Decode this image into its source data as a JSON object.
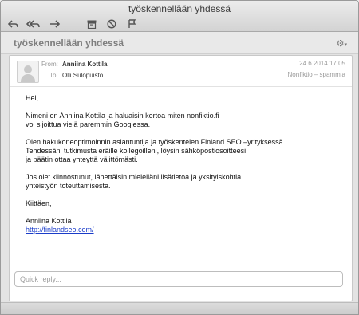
{
  "window": {
    "title": "työskennellään yhdessä"
  },
  "toolbar": {
    "reply_icon": "reply-icon",
    "reply_all_icon": "reply-all-icon",
    "forward_icon": "forward-icon",
    "archive_icon": "archive-icon",
    "junk_icon": "junk-icon",
    "flag_icon": "flag-icon"
  },
  "subject_bar": {
    "subject": "työskennellään yhdessä",
    "gear_icon": "gear-icon"
  },
  "message": {
    "from_label": "From:",
    "from_name": "Anniina Kottila",
    "to_label": "To:",
    "to_name": "Olli Sulopuisto",
    "date": "24.6.2014 17.05",
    "folder": "Nonfiktio – spammia",
    "body": {
      "greeting": "Hei,",
      "p1": "Nimeni on Anniina Kottila ja haluaisin kertoa miten nonfiktio.fi\nvoi sijoittua vielä paremmin Googlessa.",
      "p2": "Olen hakukoneoptimoinnin asiantuntija ja työskentelen Finland SEO –yrityksessä.\nTehdessäni tutkimusta eräille kollegoilleni, löysin sähköpostiosoitteesi\nja päätin ottaa yhteyttä välittömästi.",
      "p3": "Jos olet kiinnostunut, lähettäisin mielelläni lisätietoa ja yksityiskohtia\nyhteistyön toteuttamisesta.",
      "closing": "Kiittäen,",
      "signature_name": "Anniina Kottila",
      "signature_link": "http://finlandseo.com/"
    }
  },
  "quick_reply": {
    "placeholder": "Quick reply..."
  }
}
